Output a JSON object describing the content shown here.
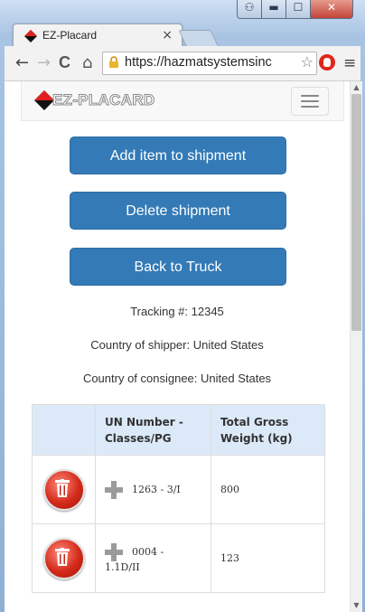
{
  "browser": {
    "tab_title": "EZ-Placard",
    "tab_close": "×",
    "url": "https://hazmatsystemsinc",
    "controls": {
      "user": "⚇",
      "minimize": "▬",
      "maximize": "☐",
      "close": "✕"
    },
    "icons": {
      "back": "←",
      "forward": "→",
      "reload": "C",
      "home": "⌂",
      "star": "☆",
      "menu": "≡"
    }
  },
  "navbar": {
    "brand": "EZ-PLACARD",
    "brand_colors": {
      "red": "#e02020",
      "black": "#111111"
    }
  },
  "actions": {
    "add_item": "Add item to shipment",
    "delete_shipment": "Delete shipment",
    "back_to_truck": "Back to Truck"
  },
  "details": {
    "tracking": "Tracking #: 12345",
    "shipper": "Country of shipper: United States",
    "consignee": "Country of consignee: United States"
  },
  "table": {
    "headers": [
      "",
      "UN Number - Classes/PG",
      "Total Gross Weight (kg)"
    ],
    "rows": [
      {
        "un": "1263 - 3/I",
        "weight": "800"
      },
      {
        "un": "0004 - 1.1D/II",
        "weight": "123"
      }
    ]
  },
  "colors": {
    "primary": "#337ab7",
    "header_bg": "#dce9f8",
    "trash_red": "#d42a1a"
  }
}
